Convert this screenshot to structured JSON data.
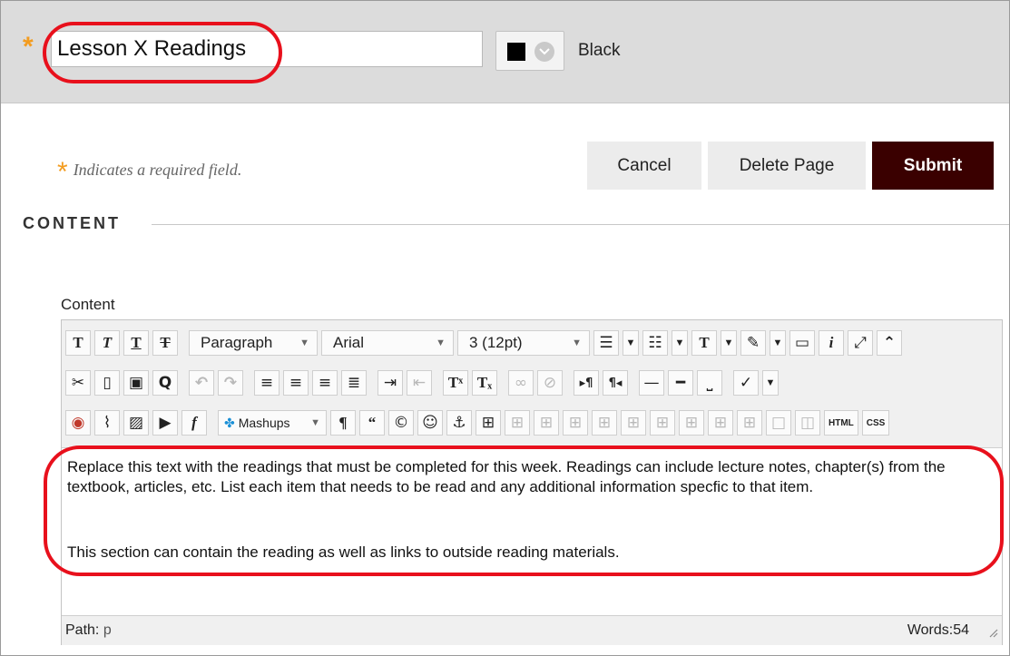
{
  "title_field": {
    "value": "Lesson X Readings"
  },
  "color_picker": {
    "swatch_color": "#000000",
    "label": "Black"
  },
  "required_note": {
    "star": "*",
    "text": "Indicates a required field."
  },
  "buttons": {
    "cancel": "Cancel",
    "delete": "Delete Page",
    "submit": "Submit"
  },
  "section": {
    "title": "CONTENT"
  },
  "content_label": "Content",
  "editor": {
    "format_select": "Paragraph",
    "font_select": "Arial",
    "size_select": "3 (12pt)",
    "mashups_label": "Mashups",
    "html_label": "HTML",
    "css_label": "CSS",
    "body": {
      "paragraph1": "Replace this text with the readings that must be completed for this week. Readings can include lecture notes, chapter(s) from the textbook, articles, etc. List each item that needs to be read and any additional information specfic to that item.",
      "paragraph2": "This section can contain the reading as well as links to outside reading materials."
    },
    "status": {
      "path_label": "Path:",
      "path_value": "p",
      "words": "Words:54"
    }
  },
  "colors": {
    "required_star": "#f39c1f",
    "submit_bg": "#3a0000",
    "highlight_ring": "#e8101c"
  }
}
